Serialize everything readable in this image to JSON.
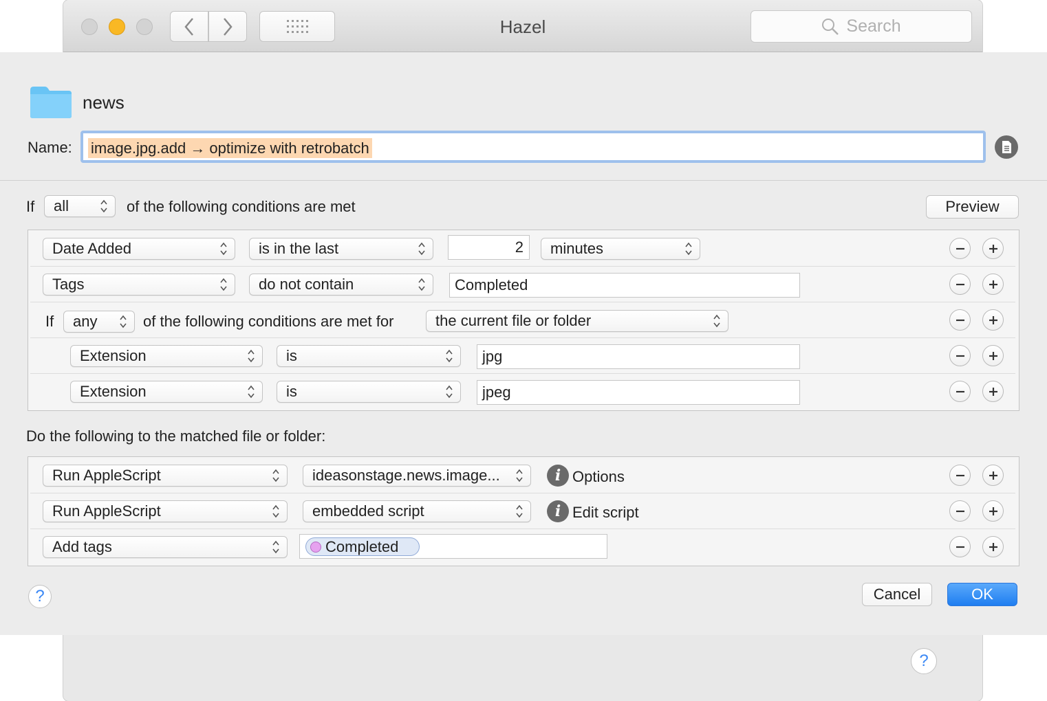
{
  "window": {
    "title": "Hazel",
    "search_placeholder": "Search"
  },
  "folder": {
    "name": "news"
  },
  "rule": {
    "name_label": "Name:",
    "name_value": "image.jpg.add → optimize with retrobatch"
  },
  "conditions": {
    "if_label": "If",
    "match_value": "all",
    "suffix": "of the following conditions are met",
    "preview_label": "Preview",
    "rows": [
      {
        "attribute": "Date Added",
        "operator": "is in the last",
        "value": "2",
        "unit": "minutes"
      },
      {
        "attribute": "Tags",
        "operator": "do not contain",
        "value": "Completed"
      }
    ],
    "nested": {
      "if_label": "If",
      "match_value": "any",
      "suffix": "of the following conditions are met for",
      "target": "the current file or folder",
      "rows": [
        {
          "attribute": "Extension",
          "operator": "is",
          "value": "jpg"
        },
        {
          "attribute": "Extension",
          "operator": "is",
          "value": "jpeg"
        }
      ]
    }
  },
  "actions": {
    "heading": "Do the following to the matched file or folder:",
    "rows": [
      {
        "action": "Run AppleScript",
        "param": "ideasonstage.news.image...",
        "link": "Options"
      },
      {
        "action": "Run AppleScript",
        "param": "embedded script",
        "link": "Edit script"
      },
      {
        "action": "Add tags",
        "tag": "Completed"
      }
    ]
  },
  "footer": {
    "cancel_label": "Cancel",
    "ok_label": "OK",
    "help_label": "?"
  },
  "colors": {
    "accent": "#1f7ef0",
    "selection": "#fdd7b1",
    "focus_ring": "#9ec0ec",
    "tag_purple": "#e6a2ef"
  }
}
